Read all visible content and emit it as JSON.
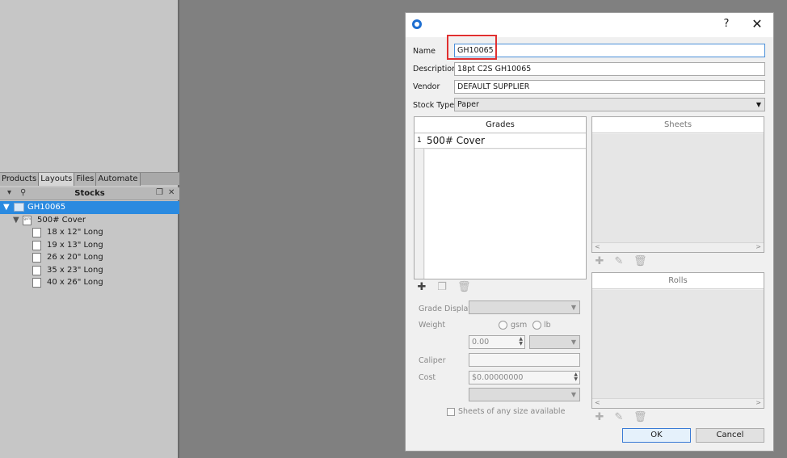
{
  "left_panel": {
    "tabs": [
      "Products",
      "Layouts",
      "Files",
      "Automate"
    ],
    "active_tab": "Layouts",
    "stocks_title": "Stocks",
    "tree": {
      "root": "GH10065",
      "grade": "500# Cover",
      "grade_icon_text": "gsm",
      "sheets": [
        "18 x 12\" Long",
        "19 x 13\" Long",
        "26 x 20\" Long",
        "35 x 23\" Long",
        "40 x 26\" Long"
      ]
    }
  },
  "dialog": {
    "help_glyph": "?",
    "close_glyph": "✕",
    "fields": {
      "name_label": "Name",
      "name_value": "GH10065",
      "description_label": "Description",
      "description_value": "18pt C2S GH10065",
      "vendor_label": "Vendor",
      "vendor_value": "DEFAULT SUPPLIER",
      "stock_type_label": "Stock Type",
      "stock_type_value": "Paper"
    },
    "grades": {
      "title": "Grades",
      "rows": [
        {
          "index": "1",
          "name": "500# Cover"
        }
      ]
    },
    "sheets_title": "Sheets",
    "rolls_title": "Rolls",
    "grade_display_label": "Grade Display",
    "weight_label": "Weight",
    "weight_options": [
      "gsm",
      "lb"
    ],
    "weight_value": "0.00",
    "caliper_label": "Caliper",
    "cost_label": "Cost",
    "cost_value": "$0.00000000",
    "sheets_any_size_label": "Sheets of any size available",
    "ok_label": "OK",
    "cancel_label": "Cancel"
  },
  "colors": {
    "selection": "#2a8ae0",
    "highlight": "#e03030",
    "default_button_border": "#3a7bd5"
  }
}
